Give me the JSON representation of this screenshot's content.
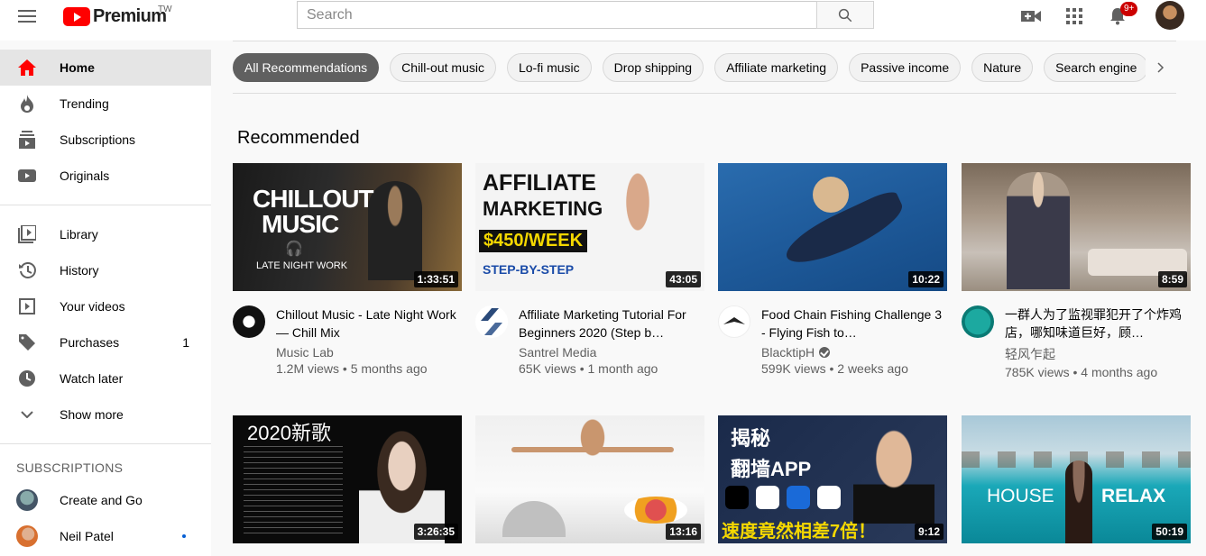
{
  "header": {
    "logo_text": "Premium",
    "region": "TW",
    "search_placeholder": "Search",
    "notifications_badge": "9+"
  },
  "sidebar": {
    "items": [
      {
        "label": "Home",
        "icon": "home-icon"
      },
      {
        "label": "Trending",
        "icon": "flame-icon"
      },
      {
        "label": "Subscriptions",
        "icon": "subscriptions-icon"
      },
      {
        "label": "Originals",
        "icon": "originals-icon"
      },
      {
        "label": "Library",
        "icon": "library-icon"
      },
      {
        "label": "History",
        "icon": "history-icon"
      },
      {
        "label": "Your videos",
        "icon": "your-videos-icon"
      },
      {
        "label": "Purchases",
        "icon": "tag-icon",
        "count": "1"
      },
      {
        "label": "Watch later",
        "icon": "clock-icon"
      },
      {
        "label": "Show more",
        "icon": "chevron-down-icon"
      }
    ],
    "subscriptions_header": "SUBSCRIPTIONS",
    "subscriptions": [
      {
        "label": "Create and Go"
      },
      {
        "label": "Neil Patel"
      }
    ]
  },
  "chips": [
    "All Recommendations",
    "Chill-out music",
    "Lo-fi music",
    "Drop shipping",
    "Affiliate marketing",
    "Passive income",
    "Nature",
    "Search engine"
  ],
  "section_title": "Recommended",
  "videos": [
    {
      "title": "Chillout Music - Late Night Work — Chill Mix",
      "channel": "Music Lab",
      "stats": "1.2M views • 5 months ago",
      "duration": "1:33:51",
      "thumb_text_1": "CHILLOUT",
      "thumb_text_2": "MUSIC",
      "thumb_text_3": "LATE NIGHT WORK"
    },
    {
      "title": "Affiliate Marketing Tutorial For Beginners 2020 (Step b…",
      "channel": "Santrel Media",
      "stats": "65K views • 1 month ago",
      "duration": "43:05",
      "thumb_text_1": "AFFILIATE",
      "thumb_text_2": "MARKETING",
      "thumb_text_3": "$450/WEEK",
      "thumb_text_4": "STEP-BY-STEP"
    },
    {
      "title": "Food Chain Fishing Challenge 3 - Flying Fish to…",
      "channel": "BlacktipH",
      "stats": "599K views • 2 weeks ago",
      "duration": "10:22",
      "verified": true
    },
    {
      "title": "一群人为了监视罪犯开了个炸鸡店，哪知味道巨好，顾…",
      "channel": "轻风乍起",
      "stats": "785K views • 4 months ago",
      "duration": "8:59"
    },
    {
      "title": "",
      "duration": "3:26:35",
      "thumb_text_1": "2020新歌"
    },
    {
      "title": "",
      "duration": "13:16"
    },
    {
      "title": "",
      "duration": "9:12",
      "thumb_text_1": "揭秘",
      "thumb_text_2": "翻墙APP",
      "thumb_text_3": "速度竟然相差7倍！"
    },
    {
      "title": "",
      "duration": "50:19",
      "thumb_text_1": "HOUSE",
      "thumb_text_2": "RELAX"
    }
  ]
}
